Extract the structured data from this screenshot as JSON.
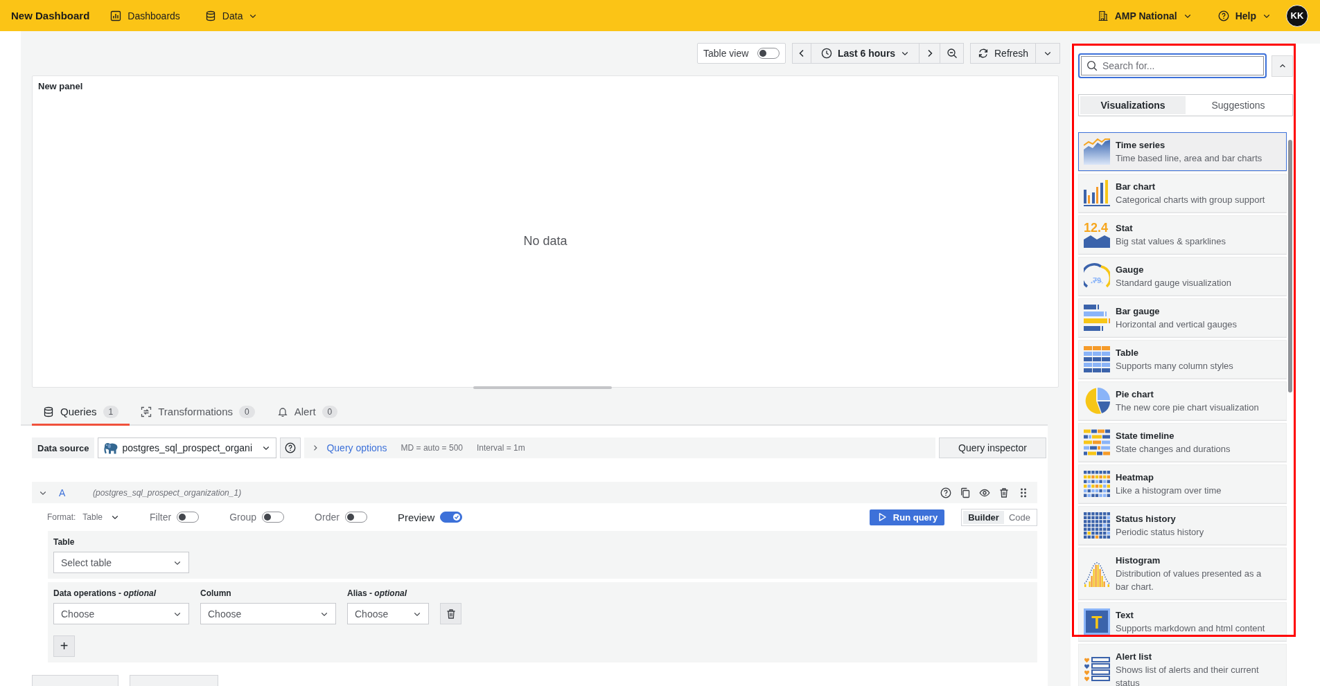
{
  "top_bar": {
    "title": "New Dashboard",
    "nav": [
      {
        "label": "Dashboards"
      },
      {
        "label": "Data"
      }
    ],
    "org": "AMP National",
    "help": "Help",
    "avatar": "KK"
  },
  "toolbar": {
    "table_view": {
      "label": "Table view",
      "on": false
    },
    "time_range": "Last 6 hours",
    "refresh": "Refresh"
  },
  "panel": {
    "title": "New panel",
    "message": "No data"
  },
  "editor_tabs": [
    {
      "label": "Queries",
      "count": "1",
      "selected": true
    },
    {
      "label": "Transformations",
      "count": "0",
      "selected": false
    },
    {
      "label": "Alert",
      "count": "0",
      "selected": false
    }
  ],
  "data_source": {
    "label": "Data source",
    "value": "postgres_sql_prospect_organi",
    "query_options": "Query options",
    "max_data_points": "MD = auto = 500",
    "interval": "Interval = 1m",
    "inspector": "Query inspector"
  },
  "query": {
    "ref": "A",
    "expanded": true,
    "name": "(postgres_sql_prospect_organization_1)",
    "format_label": "Format:",
    "format": "Table",
    "switches": [
      {
        "label": "Filter",
        "on": false
      },
      {
        "label": "Group",
        "on": false
      },
      {
        "label": "Order",
        "on": false
      },
      {
        "label": "Preview",
        "on": true
      }
    ],
    "run": "Run query",
    "modes": [
      {
        "label": "Builder",
        "selected": true
      },
      {
        "label": "Code",
        "selected": false
      }
    ],
    "table": {
      "label": "Table",
      "placeholder": "Select table"
    },
    "fields": [
      {
        "label": "Data operations - *optional*",
        "placeholder": "Choose"
      },
      {
        "label": "Column",
        "placeholder": "Choose"
      },
      {
        "label": "Alias - *optional*",
        "placeholder": "Choose"
      }
    ],
    "add": "+"
  },
  "viz_picker": {
    "highlighted": true,
    "search": {
      "placeholder": "Search for..."
    },
    "tabs": [
      {
        "label": "Visualizations",
        "selected": true
      },
      {
        "label": "Suggestions",
        "selected": false
      }
    ],
    "items": [
      {
        "kind": "timeseries",
        "name": "Time series",
        "description": "Time based line, area and bar charts",
        "selected": true
      },
      {
        "kind": "barchart",
        "name": "Bar chart",
        "description": "Categorical charts with group support",
        "selected": false
      },
      {
        "kind": "stat",
        "icon_text": "12.4",
        "name": "Stat",
        "description": "Big stat values & sparklines",
        "selected": false
      },
      {
        "kind": "gauge",
        "icon_text": "79",
        "name": "Gauge",
        "description": "Standard gauge visualization",
        "selected": false
      },
      {
        "kind": "bargauge",
        "name": "Bar gauge",
        "description": "Horizontal and vertical gauges",
        "selected": false
      },
      {
        "kind": "table",
        "name": "Table",
        "description": "Supports many column styles",
        "selected": false
      },
      {
        "kind": "piechart",
        "name": "Pie chart",
        "description": "The new core pie chart visualization",
        "selected": false
      },
      {
        "kind": "statetimeline",
        "name": "State timeline",
        "description": "State changes and durations",
        "selected": false
      },
      {
        "kind": "heatmap",
        "name": "Heatmap",
        "description": "Like a histogram over time",
        "selected": false
      },
      {
        "kind": "statushistory",
        "name": "Status history",
        "description": "Periodic status history",
        "selected": false
      },
      {
        "kind": "histogram",
        "name": "Histogram",
        "description": "Distribution of values presented as a bar chart.",
        "selected": false
      },
      {
        "kind": "text",
        "icon_text": "T",
        "name": "Text",
        "description": "Supports markdown and html content",
        "selected": false
      },
      {
        "kind": "alertlist",
        "name": "Alert list",
        "description": "Shows list of alerts and their current status",
        "selected": false
      }
    ]
  }
}
